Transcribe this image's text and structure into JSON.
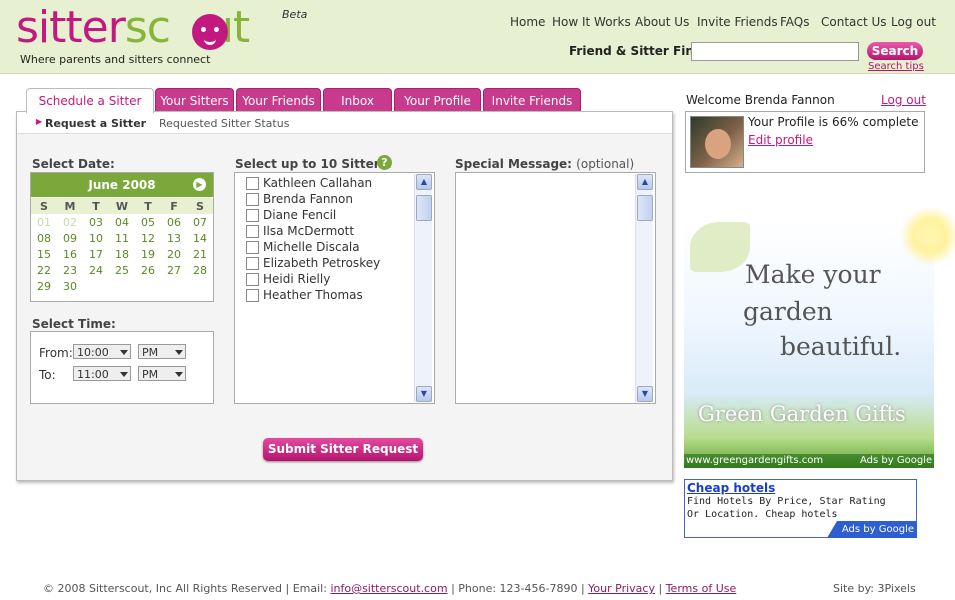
{
  "brand": {
    "logo_part1": "sitter",
    "logo_part2": "sc",
    "logo_part3": "ut",
    "beta": "Beta",
    "tagline": "Where parents and sitters connect"
  },
  "topnav": {
    "items": [
      "Home",
      "How It Works",
      "About Us",
      "Invite Friends",
      "FAQs",
      "Contact Us",
      "Log out"
    ]
  },
  "finder": {
    "label": "Friend & Sitter Finder:",
    "input_value": "",
    "search_label": "Search",
    "tips_label": "Search tips"
  },
  "tabs": [
    "Schedule a Sitter",
    "Your Sitters",
    "Your Friends",
    "Inbox",
    "Your Profile",
    "Invite Friends"
  ],
  "subtabs": [
    "Request a Sitter",
    "Requested Sitter Status"
  ],
  "date": {
    "label": "Select Date:",
    "month": "June 2008",
    "dow": [
      "S",
      "M",
      "T",
      "W",
      "T",
      "F",
      "S"
    ],
    "weeks": [
      [
        "01",
        "02",
        "03",
        "04",
        "05",
        "06",
        "07"
      ],
      [
        "08",
        "09",
        "10",
        "11",
        "12",
        "13",
        "14"
      ],
      [
        "15",
        "16",
        "17",
        "18",
        "19",
        "20",
        "21"
      ],
      [
        "22",
        "23",
        "24",
        "25",
        "26",
        "27",
        "28"
      ],
      [
        "29",
        "30",
        "",
        "",
        "",
        "",
        ""
      ]
    ]
  },
  "time": {
    "label": "Select Time:",
    "from_label": "From:",
    "to_label": "To:",
    "from_time": "10:00",
    "from_ampm": "PM",
    "to_time": "11:00",
    "to_ampm": "PM"
  },
  "sitters": {
    "label": "Select up to 10 Sitters:",
    "names": [
      "Kathleen Callahan",
      "Brenda Fannon",
      "Diane Fencil",
      "Ilsa McDermott",
      "Michelle Discala",
      "Elizabeth Petroskey",
      "Heidi Rielly",
      "Heather Thomas"
    ]
  },
  "message": {
    "label": "Special Message:",
    "optional": "(optional)",
    "value": ""
  },
  "submit_label": "Submit Sitter Request",
  "profile": {
    "welcome": "Welcome Brenda Fannon",
    "logout": "Log out",
    "completion": "Your Profile is 66% complete",
    "edit": "Edit profile"
  },
  "ad1": {
    "line1": "Make your",
    "line2": "garden",
    "line3": "beautiful.",
    "brand": "Green Garden Gifts",
    "url": "www.greengardengifts.com",
    "by": "Ads by Google"
  },
  "ad2": {
    "title": "Cheap hotels",
    "text": "Find Hotels By Price, Star Rating Or Location. Cheap hotels",
    "by": "Ads by Google"
  },
  "footer": {
    "copyright": "© 2008 Sitterscout, Inc  All Rights Reserved | Email:",
    "email": "info@sitterscout.com",
    "phone": "| Phone: 123-456-7890  |",
    "privacy": "Your Privacy",
    "sep": "|",
    "terms": "Terms of Use",
    "siteby": "Site by: 3Pixels"
  },
  "colors": {
    "brand_pink": "#c3187f",
    "brand_green": "#87b538",
    "header_bg": "#e7f0d0"
  }
}
